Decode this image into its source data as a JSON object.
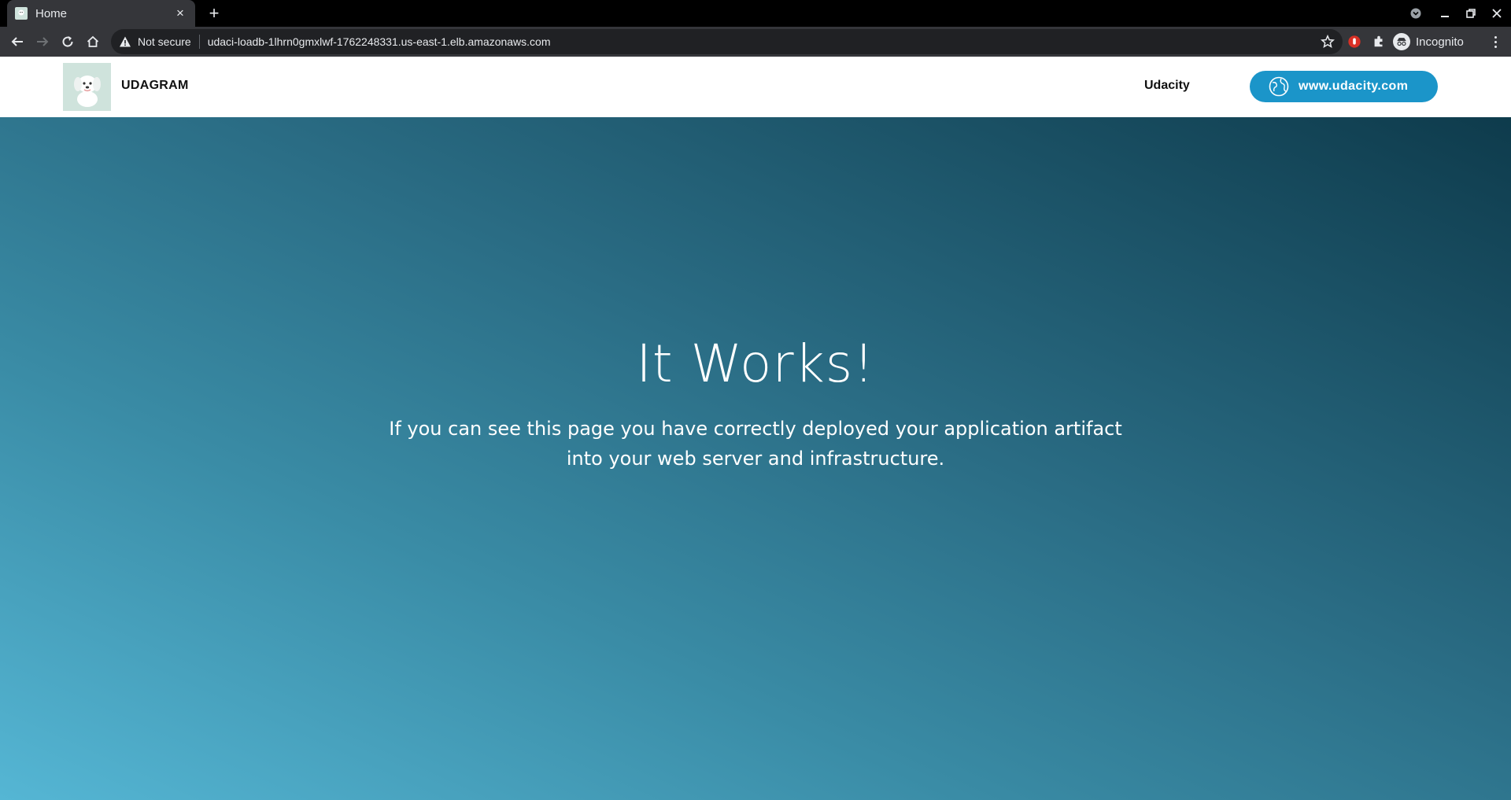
{
  "browser": {
    "tab_title": "Home",
    "tab_close": "×",
    "new_tab": "+",
    "security_label": "Not secure",
    "url": "udaci-loadb-1lhrn0gmxlwf-1762248331.us-east-1.elb.amazonaws.com",
    "profile_label": "Incognito"
  },
  "site": {
    "brand": "UDAGRAM",
    "nav_link": "Udacity",
    "cta_label": "www.udacity.com"
  },
  "hero": {
    "heading": "It Works!",
    "text": "If you can see this page you have correctly deployed your application artifact into your web server and infrastructure."
  },
  "colors": {
    "cta": "#1b95c9",
    "hero_start": "#55b6d4",
    "hero_end": "#0e3b4c",
    "chrome_dark": "#35363a"
  },
  "icons": {
    "favicon": "dog-favicon-icon",
    "back": "back-arrow-icon",
    "forward": "forward-arrow-icon",
    "reload": "reload-icon",
    "home": "home-icon",
    "warning": "warning-triangle-icon",
    "star": "bookmark-star-icon",
    "extension_red": "red-hand-extension-icon",
    "extensions": "puzzle-icon",
    "incognito": "incognito-icon",
    "globe": "globe-icon"
  }
}
